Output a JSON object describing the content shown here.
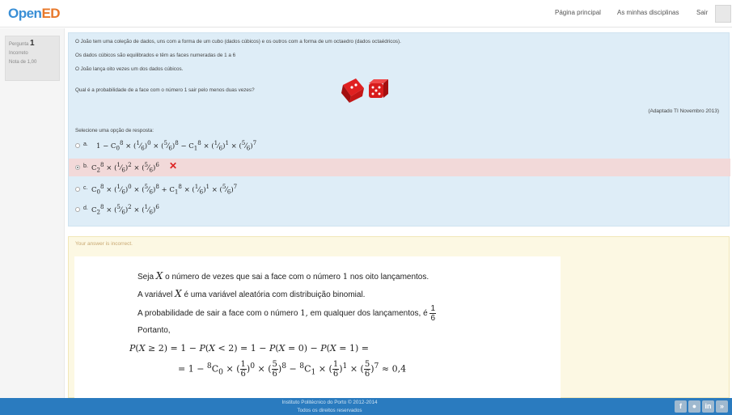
{
  "header": {
    "logo_open": "Open",
    "logo_ed": "ED",
    "nav": [
      "Página principal",
      "As minhas disciplinas",
      "Sair"
    ]
  },
  "sidebar": {
    "question_label": "Pergunta",
    "question_number": "1",
    "state": "Incorreto",
    "grade": "Nota de 1,00"
  },
  "question": {
    "lines": [
      "O João tem uma coleção de dados, uns com a forma de um cubo (dados cúbicos) e os outros com a forma de um octaedro (dados octaédricos).",
      "Os dados cúbicos são equilibrados e têm as faces numeradas de 1 a 6",
      "O João lança oito vezes um dos dados cúbicos.",
      "Qual é a probabilidade de a face com o número 1 sair pelo menos duas vezes?"
    ],
    "source": "(Adaptado TI Novembro 2013)",
    "prompt": "Selecione uma opção de resposta:",
    "options": [
      {
        "label": "a.",
        "selected": false,
        "wrong": false
      },
      {
        "label": "b.",
        "selected": true,
        "wrong": true
      },
      {
        "label": "c.",
        "selected": false,
        "wrong": false
      },
      {
        "label": "d.",
        "selected": false,
        "wrong": false
      }
    ],
    "wrong_mark": "✕"
  },
  "feedback": {
    "heading": "Your answer is incorrect.",
    "text1_a": "Seja",
    "text1_b": "o número de vezes que sai a face com o número",
    "text1_c": "nos oito lançamentos.",
    "text2_a": "A variável",
    "text2_b": "é uma variável aleatória com distribuição binomial.",
    "text3": "A probabilidade de sair a face com o número",
    "text3_b": "em qualquer dos lançamentos, é",
    "text4": "Portanto,",
    "result": "≈ 0,4"
  },
  "footer": {
    "line1": "Instituto Politécnico do Porto © 2012-2014",
    "line2": "Todos os direitos reservados",
    "social_icons": [
      "facebook-icon",
      "flickr-icon",
      "linkedin-icon",
      "rss-icon"
    ]
  },
  "colors": {
    "question_bg": "#deedf7",
    "feedback_bg": "#fcf8e3",
    "wrong_bg": "#f2d9d9",
    "footer_bg": "#2a7bbf"
  }
}
